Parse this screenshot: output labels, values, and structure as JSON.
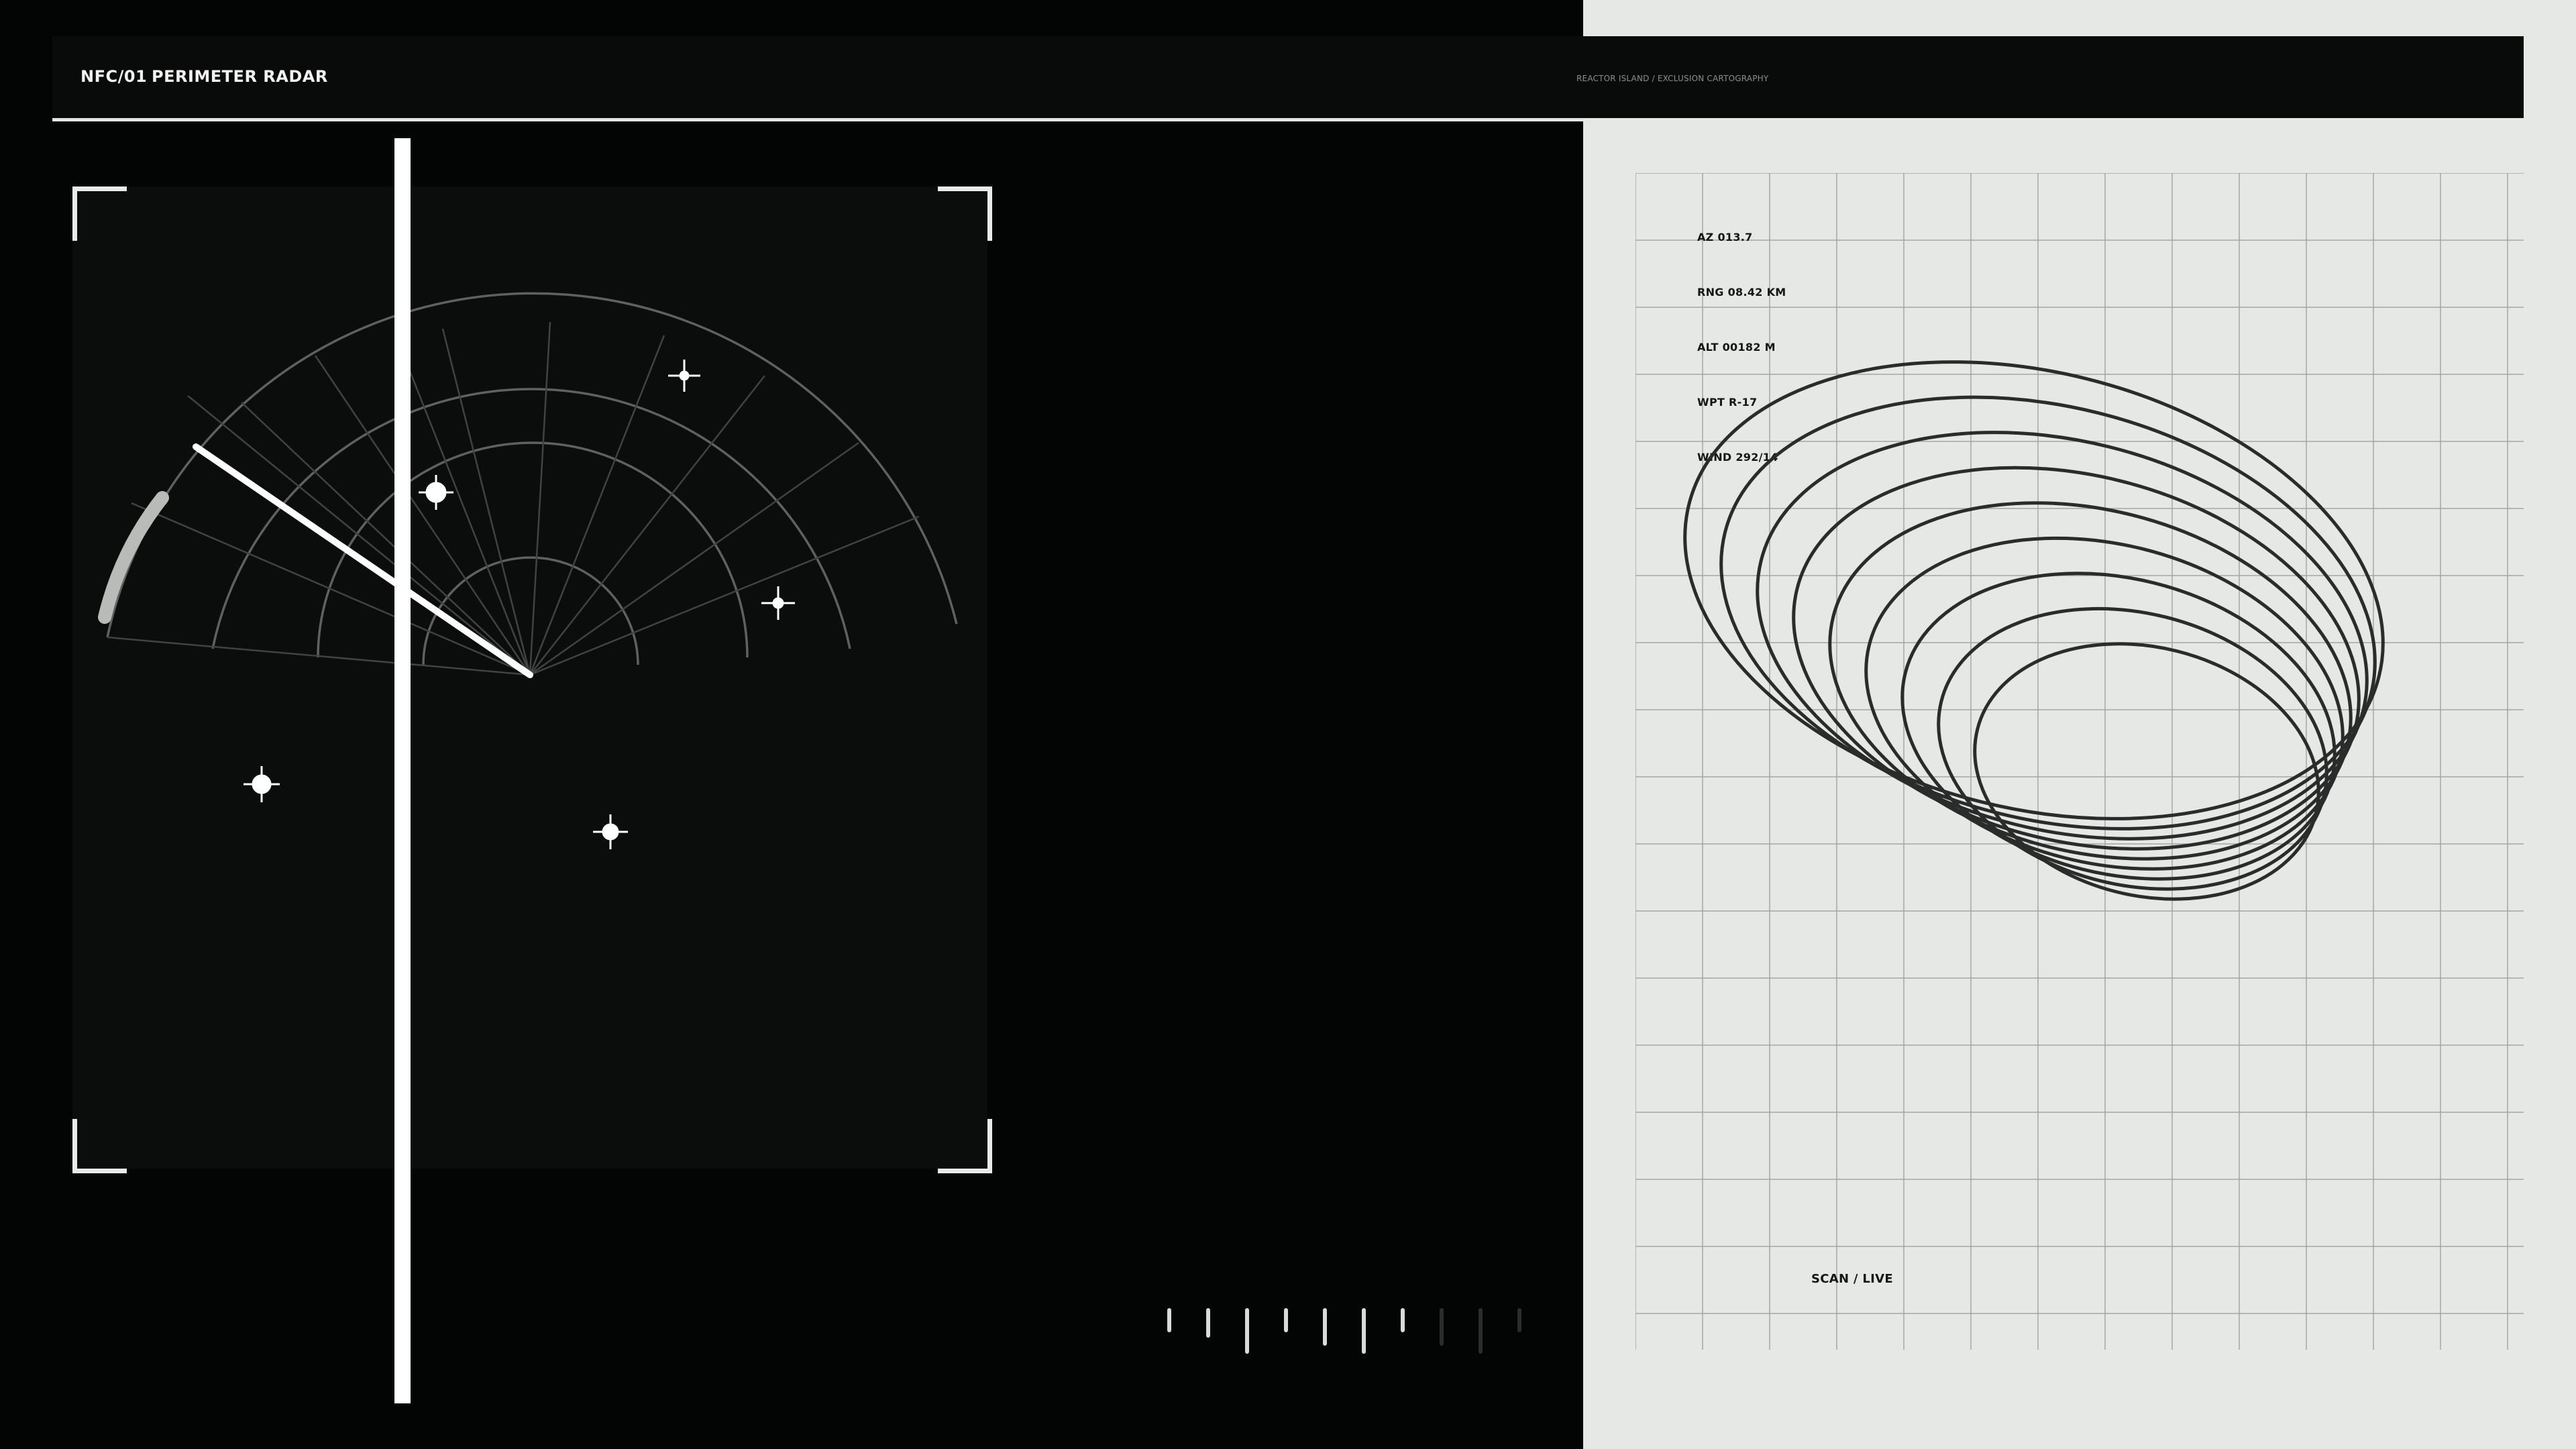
{
  "header": {
    "code": "NFC/01",
    "title": "PERIMETER RADAR",
    "subtitle": "REACTOR ISLAND / EXCLUSION CARTOGRAPHY"
  },
  "readouts": [
    {
      "id": "azimuth",
      "text": "AZ 013.7"
    },
    {
      "id": "range",
      "text": "RNG 08.42 KM"
    },
    {
      "id": "altitude",
      "text": "ALT 00182 M"
    },
    {
      "id": "waypoint",
      "text": "WPT R-17"
    },
    {
      "id": "wind",
      "text": "WIND 292/14"
    }
  ],
  "status": {
    "scan": "SCAN / LIVE"
  },
  "colors": {
    "dark_bg": "#030504",
    "panel_bg": "#0b0d0c",
    "light_bg": "#e6e8e5",
    "accent": "#ffffff",
    "grid": "#9ea19f",
    "contour": "#2a2c2b"
  },
  "radar": {
    "contacts": [
      {
        "id": "contact-1",
        "style": "plus"
      },
      {
        "id": "contact-2",
        "style": "disc"
      },
      {
        "id": "contact-3",
        "style": "plus"
      },
      {
        "id": "contact-4",
        "style": "disc"
      },
      {
        "id": "contact-5",
        "style": "disc"
      }
    ]
  },
  "tick_meter": {
    "levels": [
      0.45,
      0.55,
      0.85,
      0.45,
      0.7,
      0.85,
      0.45,
      0.7,
      0.85,
      0.45
    ]
  },
  "icons": [
    "corner-bracket-icon",
    "contact-crosshair-icon",
    "sweep-line-icon"
  ]
}
